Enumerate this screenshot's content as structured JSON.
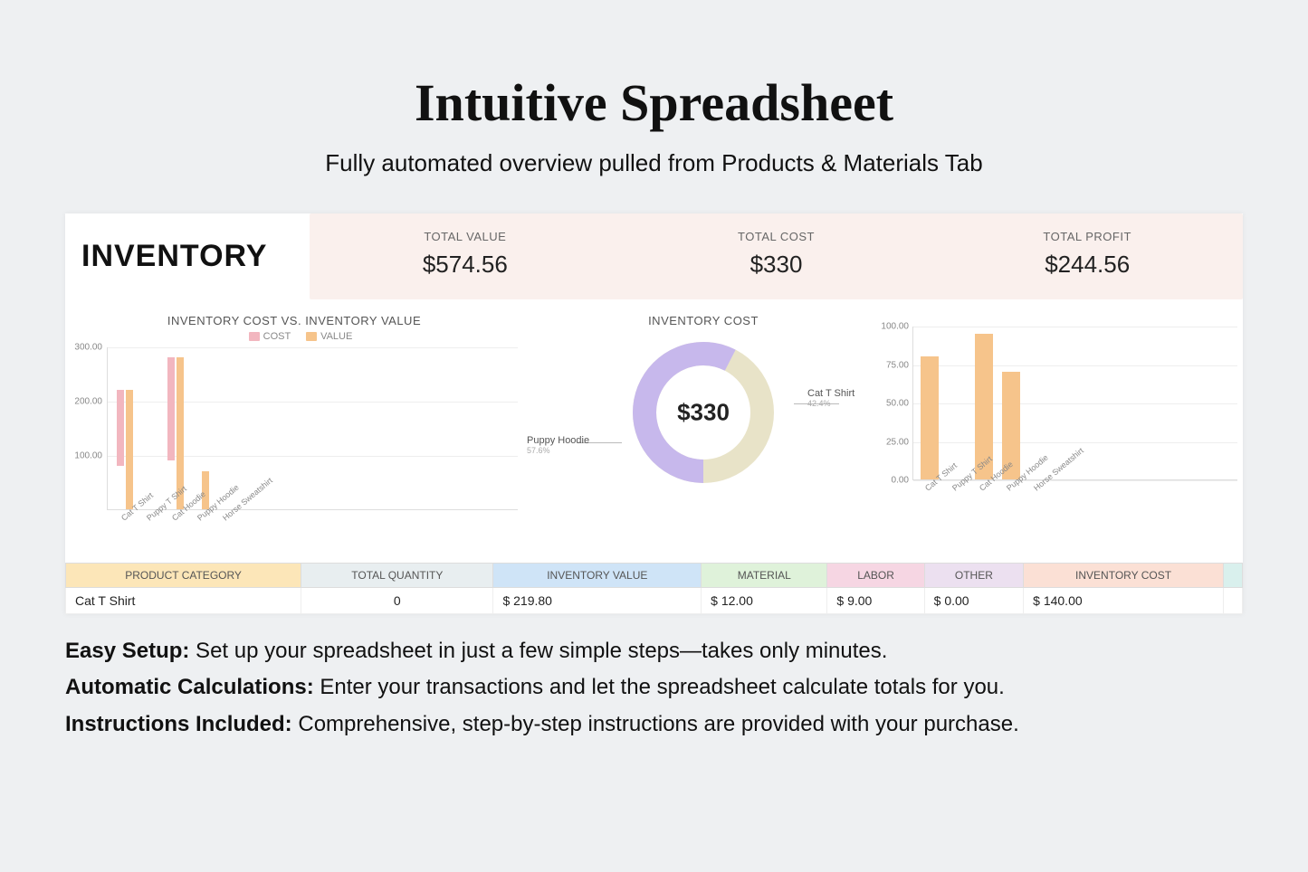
{
  "title": "Intuitive Spreadsheet",
  "subtitle": "Fully automated overview pulled from Products & Materials Tab",
  "inventory_label": "INVENTORY",
  "kpis": [
    {
      "label": "TOTAL VALUE",
      "value": "$574.56"
    },
    {
      "label": "TOTAL COST",
      "value": "$330"
    },
    {
      "label": "TOTAL PROFIT",
      "value": "$244.56"
    }
  ],
  "chart1_title": "INVENTORY COST VS. INVENTORY VALUE",
  "legend_cost": "COST",
  "legend_value": "VALUE",
  "chart2_title": "INVENTORY COST",
  "donut_center": "$330",
  "donut_label_right": "Cat T Shirt",
  "donut_label_right_sub": "42.4%",
  "donut_label_left": "Puppy Hoodie",
  "donut_label_left_sub": "57.6%",
  "table": {
    "headers": [
      "PRODUCT CATEGORY",
      "TOTAL QUANTITY",
      "INVENTORY VALUE",
      "MATERIAL",
      "LABOR",
      "OTHER",
      "INVENTORY COST"
    ],
    "row": {
      "category": "Cat T Shirt",
      "qty": "0",
      "value": "$  219.80",
      "material": "$  12.00",
      "labor": "$  9.00",
      "other": "$  0.00",
      "invcost": "$  140.00"
    }
  },
  "features": [
    {
      "b": "Easy Setup:",
      "t": " Set up your spreadsheet in just a few simple steps—takes only minutes."
    },
    {
      "b": "Automatic Calculations:",
      "t": " Enter your transactions and let the spreadsheet calculate totals for you."
    },
    {
      "b": "Instructions Included:",
      "t": " Comprehensive, step-by-step instructions are provided with your purchase."
    }
  ],
  "chart_data": [
    {
      "type": "bar",
      "title": "INVENTORY COST VS. INVENTORY VALUE",
      "categories": [
        "Cat T Shirt",
        "Puppy T Shirt",
        "Cat Hoodie",
        "Puppy Hoodie",
        "Horse Sweatshirt"
      ],
      "series": [
        {
          "name": "COST",
          "values": [
            140,
            0,
            190,
            0,
            0
          ]
        },
        {
          "name": "VALUE",
          "values": [
            220,
            0,
            280,
            70,
            0
          ]
        }
      ],
      "ylim": [
        0,
        300
      ],
      "yticks": [
        100,
        200,
        300
      ]
    },
    {
      "type": "pie",
      "title": "INVENTORY COST",
      "center_label": "$330",
      "series": [
        {
          "name": "Cat T Shirt",
          "value": 140,
          "pct": 42.4
        },
        {
          "name": "Puppy Hoodie",
          "value": 190,
          "pct": 57.6
        }
      ]
    },
    {
      "type": "bar",
      "title": "",
      "categories": [
        "Cat T Shirt",
        "Puppy T Shirt",
        "Cat Hoodie",
        "Puppy Hoodie",
        "Horse Sweatshirt"
      ],
      "values": [
        80,
        0,
        95,
        70,
        0
      ],
      "ylim": [
        0,
        100
      ],
      "yticks": [
        0,
        25,
        50,
        75,
        100
      ]
    }
  ]
}
